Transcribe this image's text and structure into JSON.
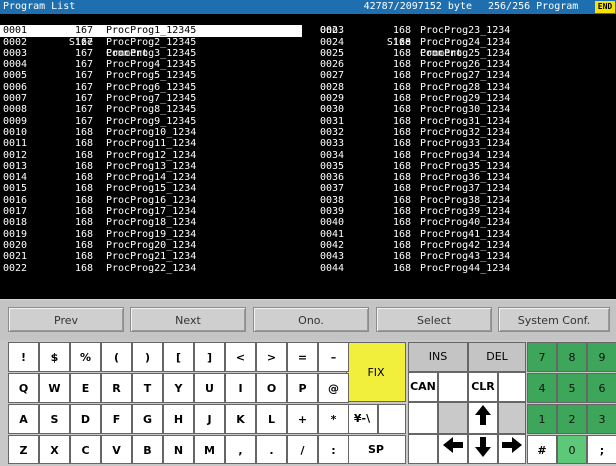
{
  "titlebar": {
    "title": "Program List",
    "bytes": "42787/2097152 byte",
    "count": "256/256 Program",
    "end_label": "END"
  },
  "list": {
    "headers": {
      "no": "Ono.",
      "size": "Size",
      "comment": "Comment"
    },
    "left": [
      {
        "no": "0001",
        "size": "167",
        "comment": "ProcProg1_12345",
        "selected": true
      },
      {
        "no": "0002",
        "size": "167",
        "comment": "ProcProg2_12345"
      },
      {
        "no": "0003",
        "size": "167",
        "comment": "ProcProg3_12345"
      },
      {
        "no": "0004",
        "size": "167",
        "comment": "ProcProg4_12345"
      },
      {
        "no": "0005",
        "size": "167",
        "comment": "ProcProg5_12345"
      },
      {
        "no": "0006",
        "size": "167",
        "comment": "ProcProg6_12345"
      },
      {
        "no": "0007",
        "size": "167",
        "comment": "ProcProg7_12345"
      },
      {
        "no": "0008",
        "size": "167",
        "comment": "ProcProg8_12345"
      },
      {
        "no": "0009",
        "size": "167",
        "comment": "ProcProg9_12345"
      },
      {
        "no": "0010",
        "size": "168",
        "comment": "ProcProg10_1234"
      },
      {
        "no": "0011",
        "size": "168",
        "comment": "ProcProg11_1234"
      },
      {
        "no": "0012",
        "size": "168",
        "comment": "ProcProg12_1234"
      },
      {
        "no": "0013",
        "size": "168",
        "comment": "ProcProg13_1234"
      },
      {
        "no": "0014",
        "size": "168",
        "comment": "ProcProg14_1234"
      },
      {
        "no": "0015",
        "size": "168",
        "comment": "ProcProg15_1234"
      },
      {
        "no": "0016",
        "size": "168",
        "comment": "ProcProg16_1234"
      },
      {
        "no": "0017",
        "size": "168",
        "comment": "ProcProg17_1234"
      },
      {
        "no": "0018",
        "size": "168",
        "comment": "ProcProg18_1234"
      },
      {
        "no": "0019",
        "size": "168",
        "comment": "ProcProg19_1234"
      },
      {
        "no": "0020",
        "size": "168",
        "comment": "ProcProg20_1234"
      },
      {
        "no": "0021",
        "size": "168",
        "comment": "ProcProg21_1234"
      },
      {
        "no": "0022",
        "size": "168",
        "comment": "ProcProg22_1234"
      }
    ],
    "right": [
      {
        "no": "0023",
        "size": "168",
        "comment": "ProcProg23_1234"
      },
      {
        "no": "0024",
        "size": "168",
        "comment": "ProcProg24_1234"
      },
      {
        "no": "0025",
        "size": "168",
        "comment": "ProcProg25_1234"
      },
      {
        "no": "0026",
        "size": "168",
        "comment": "ProcProg26_1234"
      },
      {
        "no": "0027",
        "size": "168",
        "comment": "ProcProg27_1234"
      },
      {
        "no": "0028",
        "size": "168",
        "comment": "ProcProg28_1234"
      },
      {
        "no": "0029",
        "size": "168",
        "comment": "ProcProg29_1234"
      },
      {
        "no": "0030",
        "size": "168",
        "comment": "ProcProg30_1234"
      },
      {
        "no": "0031",
        "size": "168",
        "comment": "ProcProg31_1234"
      },
      {
        "no": "0032",
        "size": "168",
        "comment": "ProcProg32_1234"
      },
      {
        "no": "0033",
        "size": "168",
        "comment": "ProcProg33_1234"
      },
      {
        "no": "0034",
        "size": "168",
        "comment": "ProcProg34_1234"
      },
      {
        "no": "0035",
        "size": "168",
        "comment": "ProcProg35_1234"
      },
      {
        "no": "0036",
        "size": "168",
        "comment": "ProcProg36_1234"
      },
      {
        "no": "0037",
        "size": "168",
        "comment": "ProcProg37_1234"
      },
      {
        "no": "0038",
        "size": "168",
        "comment": "ProcProg38_1234"
      },
      {
        "no": "0039",
        "size": "168",
        "comment": "ProcProg39_1234"
      },
      {
        "no": "0040",
        "size": "168",
        "comment": "ProcProg40_1234"
      },
      {
        "no": "0041",
        "size": "168",
        "comment": "ProcProg41_1234"
      },
      {
        "no": "0042",
        "size": "168",
        "comment": "ProcProg42_1234"
      },
      {
        "no": "0043",
        "size": "168",
        "comment": "ProcProg43_1234"
      },
      {
        "no": "0044",
        "size": "168",
        "comment": "ProcProg44_1234"
      }
    ]
  },
  "fkeys": {
    "prev": "Prev",
    "next": "Next",
    "ono": "Ono.",
    "select": "Select",
    "sysconf": "System Conf."
  },
  "keyboard": {
    "row1": [
      "!",
      "$",
      "%",
      "(",
      ")",
      "[",
      "]",
      "<",
      ">",
      "=",
      "–"
    ],
    "row2": [
      "Q",
      "W",
      "E",
      "R",
      "T",
      "Y",
      "U",
      "I",
      "O",
      "P",
      "@"
    ],
    "row3": [
      "A",
      "S",
      "D",
      "F",
      "G",
      "H",
      "J",
      "K",
      "L",
      "+",
      "*"
    ],
    "row4": [
      "Z",
      "X",
      "C",
      "V",
      "B",
      "N",
      "M",
      ",",
      ".",
      "/",
      ":"
    ],
    "fix": "FIX",
    "yen": "¥-\\",
    "sp": "SP",
    "ins": "INS",
    "del": "DEL",
    "can": "CAN",
    "clr": "CLR",
    "num": [
      "7",
      "8",
      "9",
      "4",
      "5",
      "6",
      "1",
      "2",
      "3",
      "#",
      "0",
      ";"
    ],
    "arrows": [
      "up-arrow-icon",
      "down-arrow-icon",
      "left-arrow-icon",
      "right-arrow-icon"
    ],
    "colors": {
      "fix": "#f2ee3c",
      "num": "#3ea65a",
      "num_zero": "#5cc878"
    }
  }
}
